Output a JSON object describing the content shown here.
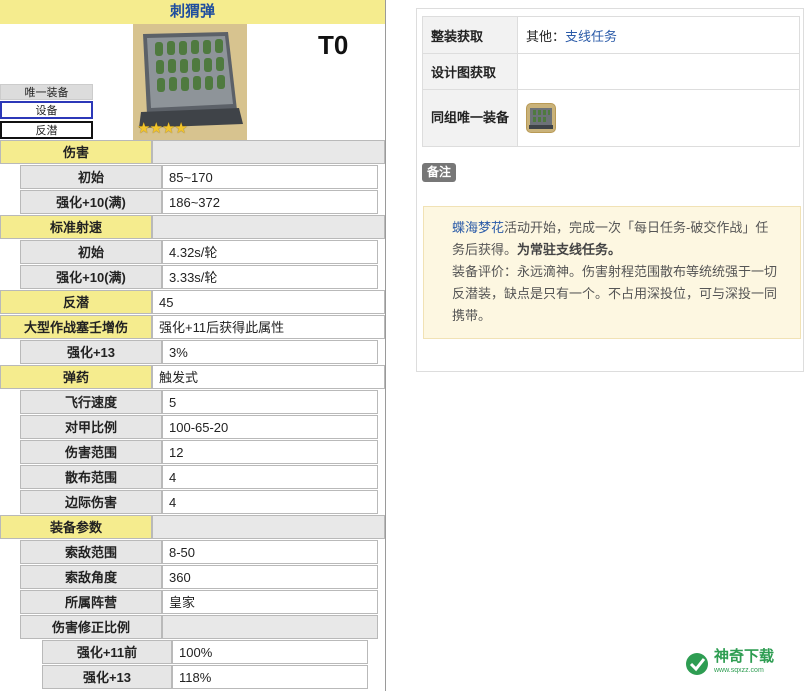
{
  "equipment": {
    "name": "刺猬弹",
    "tier": "T0",
    "tags": [
      "唯一装备",
      "设备",
      "反潜"
    ],
    "rows": [
      {
        "kind": "hdr",
        "label": "伤害",
        "value": ""
      },
      {
        "kind": "sub",
        "label": "初始",
        "value": "85~170"
      },
      {
        "kind": "sub",
        "label": "强化+10(满)",
        "value": "186~372"
      },
      {
        "kind": "hdr",
        "label": "标准射速",
        "value": ""
      },
      {
        "kind": "sub",
        "label": "初始",
        "value": "4.32s/轮"
      },
      {
        "kind": "sub",
        "label": "强化+10(满)",
        "value": "3.33s/轮"
      },
      {
        "kind": "hdr",
        "label": "反潜",
        "value": "45"
      },
      {
        "kind": "hdr",
        "label": "大型作战塞壬增伤",
        "value": "强化+11后获得此属性"
      },
      {
        "kind": "sub",
        "label": "强化+13",
        "value": "3%"
      },
      {
        "kind": "hdr",
        "label": "弹药",
        "value": "触发式"
      },
      {
        "kind": "sub",
        "label": "飞行速度",
        "value": "5"
      },
      {
        "kind": "sub",
        "label": "对甲比例",
        "value": "100-65-20"
      },
      {
        "kind": "sub",
        "label": "伤害范围",
        "value": "12"
      },
      {
        "kind": "sub",
        "label": "散布范围",
        "value": "4"
      },
      {
        "kind": "sub",
        "label": "边际伤害",
        "value": "4"
      },
      {
        "kind": "hdr",
        "label": "装备参数",
        "value": ""
      },
      {
        "kind": "sub",
        "label": "索敌范围",
        "value": "8-50"
      },
      {
        "kind": "sub",
        "label": "索敌角度",
        "value": "360"
      },
      {
        "kind": "sub",
        "label": "所属阵营",
        "value": "皇家"
      },
      {
        "kind": "sub",
        "label": "伤害修正比例",
        "value": ""
      },
      {
        "kind": "sub2",
        "label": "强化+11前",
        "value": "100%"
      },
      {
        "kind": "sub2",
        "label": "强化+13",
        "value": "118%"
      }
    ]
  },
  "acquire": {
    "rows": [
      {
        "label": "整装获取",
        "prefix": "其他：",
        "link": "支线任务"
      },
      {
        "label": "设计图获取",
        "prefix": "",
        "link": ""
      },
      {
        "label": "同组唯一装备",
        "prefix": "",
        "link": ""
      }
    ]
  },
  "notes": {
    "badge": "备注",
    "link": "蝶海梦花",
    "text1": "活动开始，完成一次「每日任务-破交作战」任务后获得。",
    "bold": "为常驻支线任务。",
    "text2": "装备评价：永远滴神。伤害射程范围散布等统统强于一切反潜装，缺点是只有一个。不占用深投位，可与深投一同携带。"
  },
  "watermark": {
    "name": "神奇下载",
    "url": "www.sqxzz.com"
  }
}
